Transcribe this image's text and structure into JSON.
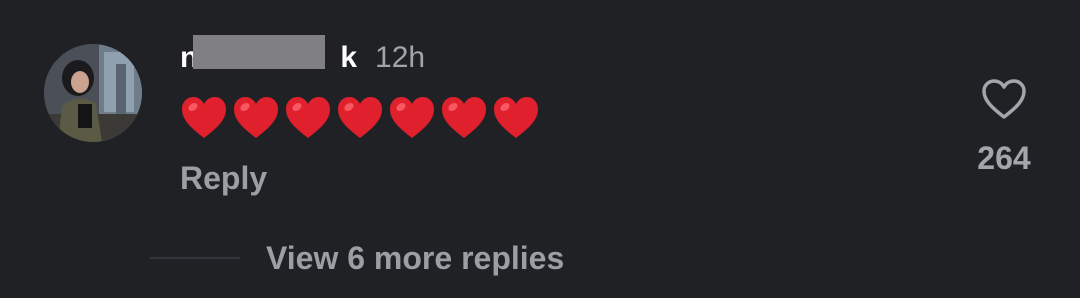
{
  "comment": {
    "username_start": "n",
    "username_end": "k",
    "timestamp": "12h",
    "text": "❤️❤️❤️❤️❤️❤️❤️",
    "heart_count": 7,
    "reply_label": "Reply",
    "like_count": "264",
    "view_more_label": "View 6 more replies"
  },
  "icons": {
    "like": "heart-outline-icon",
    "emoji": "red-heart-emoji"
  },
  "colors": {
    "background": "#202125",
    "secondary_text": "#9c9ea4",
    "emoji_red": "#e0212d"
  }
}
